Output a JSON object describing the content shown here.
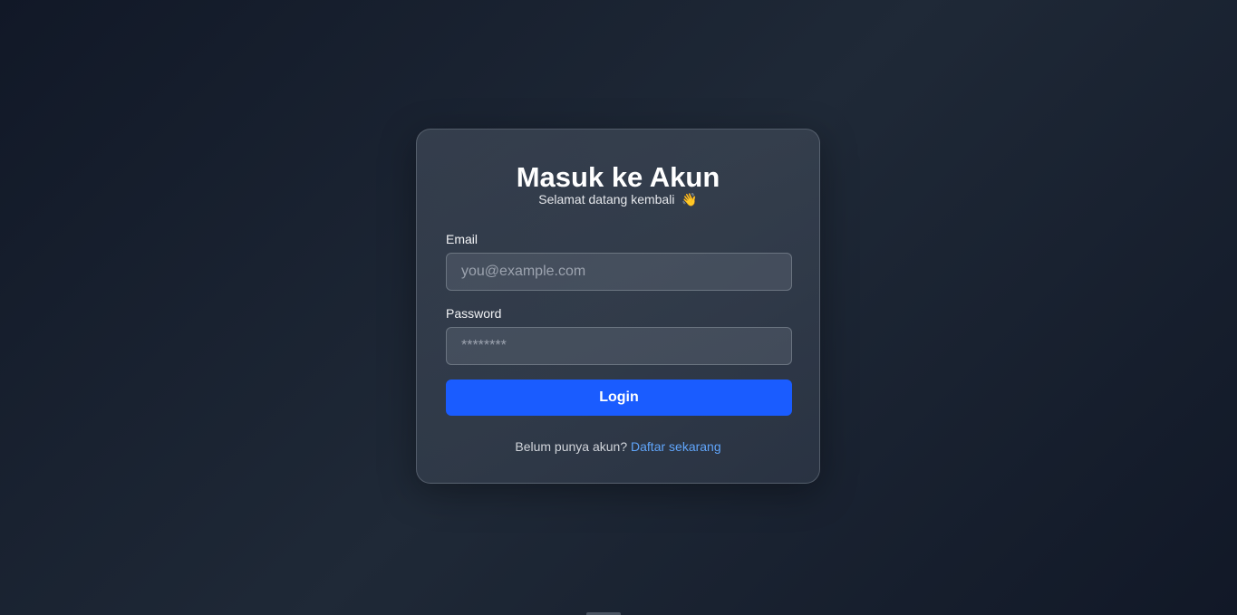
{
  "login_card": {
    "title": "Masuk ke Akun",
    "subtitle": "Selamat datang kembali",
    "subtitle_emoji": "👋",
    "email": {
      "label": "Email",
      "placeholder": "you@example.com",
      "value": ""
    },
    "password": {
      "label": "Password",
      "placeholder": "********",
      "value": ""
    },
    "login_button_label": "Login",
    "footer": {
      "prompt": "Belum punya akun?",
      "register_link": "Daftar sekarang"
    }
  },
  "colors": {
    "background": "#111827",
    "accent_button": "#1a5cff",
    "link": "#60a5fa"
  },
  "icons": {
    "wave": "waving-hand-icon"
  }
}
